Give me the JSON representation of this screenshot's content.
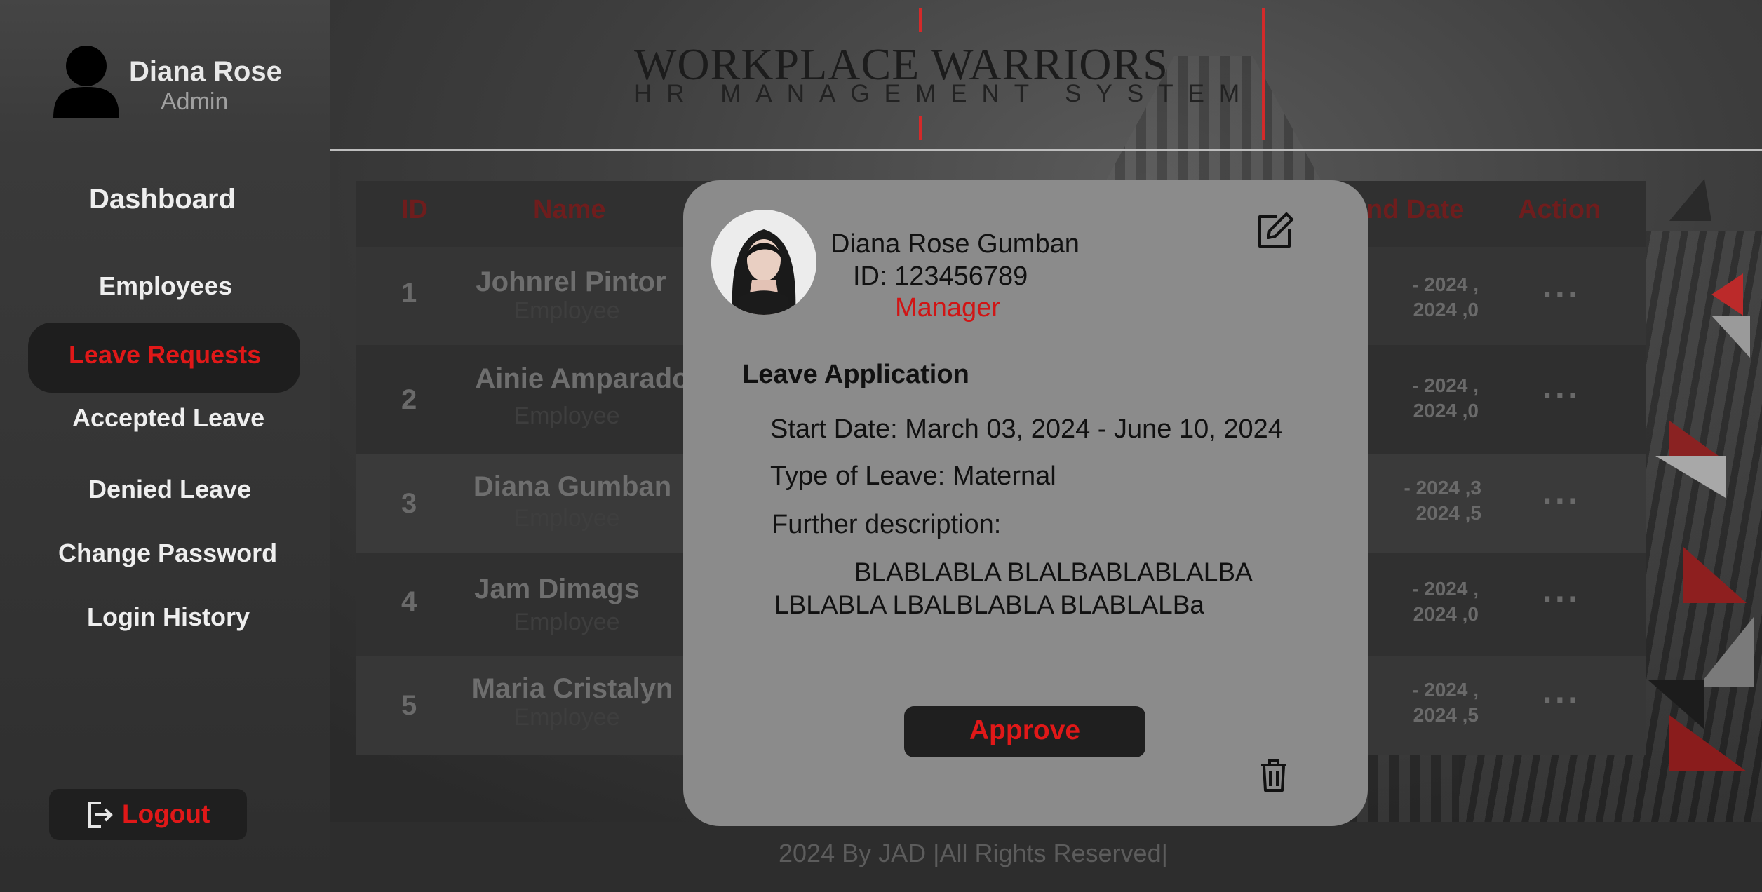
{
  "app": {
    "brand_title": "WORKPLACE WARRIORS",
    "brand_subtitle": "HR MANAGEMENT SYSTEM",
    "accent_color": "#d42a2a"
  },
  "user": {
    "name": "Diana Rose",
    "role": "Admin",
    "avatar_icon": "user-silhouette-icon"
  },
  "sidebar": {
    "items": [
      {
        "label": "Dashboard"
      },
      {
        "label": "Employees"
      },
      {
        "label": "Leave Requests",
        "active": true
      },
      {
        "label": "Accepted Leave"
      },
      {
        "label": "Denied Leave"
      },
      {
        "label": "Change Password"
      },
      {
        "label": "Login History"
      }
    ],
    "logout_label": "Logout",
    "logout_icon": "logout-icon"
  },
  "table": {
    "headers": {
      "id": "ID",
      "name": "Name",
      "end_date": "nd Date",
      "action": "Action"
    },
    "rows": [
      {
        "id": "1",
        "name": "Johnrel Pintor",
        "role": "Employee",
        "dates": ", 2024 -\n0, 2024",
        "action": "..."
      },
      {
        "id": "2",
        "name": "Ainie Amparado",
        "role": "Employee",
        "dates": ", 2024 -\n0, 2024",
        "action": "..."
      },
      {
        "id": "3",
        "name": "Diana Gumban",
        "role": "Employee",
        "dates": "3, 2024 -\n5, 2024",
        "action": "..."
      },
      {
        "id": "4",
        "name": "Jam Dimags",
        "role": "Employee",
        "dates": ", 2024 -\n0, 2024",
        "action": "..."
      },
      {
        "id": "5",
        "name": "Maria Cristalyn",
        "role": "Employee",
        "dates": ", 2024 -\n5, 2024",
        "action": "..."
      }
    ]
  },
  "footer": {
    "text": "2024 By JAD |All Rights Reserved|"
  },
  "modal": {
    "employee_name": "Diana Rose Gumban",
    "employee_id": "ID: 123456789",
    "employee_role": "Manager",
    "heading": "Leave Application",
    "start_date": "Start Date: March 03, 2024 - June 10, 2024",
    "leave_type": "Type of Leave: Maternal",
    "description_label": "Further description:",
    "description": "BLABLABLA  BLALBABLABLALBA LBLABLA LBALBLABLA BLABLALBa",
    "approve_label": "Approve",
    "edit_icon": "edit-icon",
    "delete_icon": "trash-icon"
  }
}
